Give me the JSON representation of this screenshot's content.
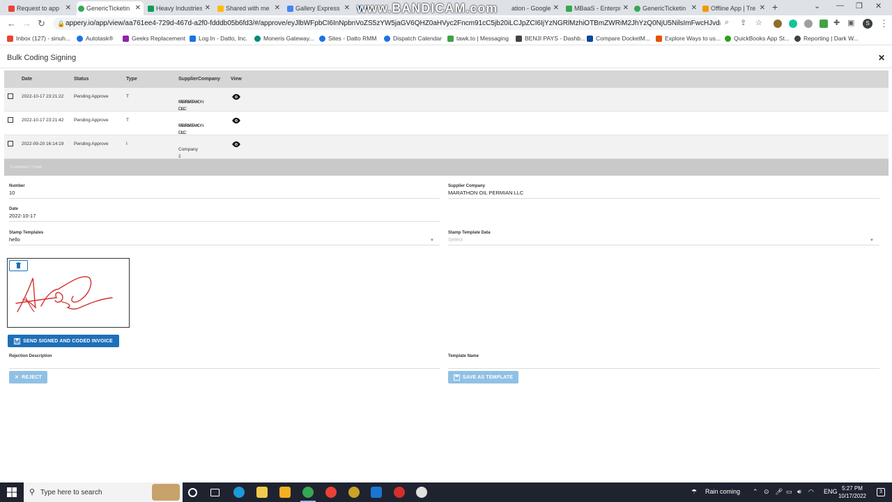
{
  "browser": {
    "tabs": [
      {
        "label": "Request to app",
        "color": "#ea4335"
      },
      {
        "label": "GenericTicketin",
        "color": "#34a853"
      },
      {
        "label": "Heavy Industries",
        "color": "#0f9d58"
      },
      {
        "label": "Shared with me",
        "color": "#fbbc04"
      },
      {
        "label": "Gallery Express",
        "color": "#4285f4"
      },
      {
        "label": "Au",
        "color": "#1a73e8"
      },
      {
        "label": "ation - Google",
        "color": "#4285f4"
      },
      {
        "label": "MBaaS - Enterpr",
        "color": "#34a853"
      },
      {
        "label": "GenericTicketin",
        "color": "#34a853"
      },
      {
        "label": "Offline App | Tre",
        "color": "#f29900"
      }
    ],
    "url": "appery.io/app/view/aa761ee4-729d-467d-a2f0-fdddb05b6fd3/#/approve/eyJlbWFpbCI6InNpbnVoZS5zYW5jaGV6QHZ0aHVyc2Fncm91cC5jb20iLCJpZCI6IjYzNGRlMzhiOTBmZWRiM2JhYzQ0NjU5NilsImFwcHJvdmVySWQiOiI2MzEx...",
    "bandicam": "www.BANDICAM.com",
    "profile_initial": "S",
    "bookmarks": [
      {
        "label": "Inbox (127) - sinuh...",
        "color": "#ea4335"
      },
      {
        "label": "Autotask®",
        "color": "#1a73e8"
      },
      {
        "label": "Geeks Replacement",
        "color": "#8e24aa"
      },
      {
        "label": "Log In - Datto, Inc.",
        "color": "#1a73e8"
      },
      {
        "label": "Moneris Gateway...",
        "color": "#00897b"
      },
      {
        "label": "Sites - Datto RMM",
        "color": "#1a73e8"
      },
      {
        "label": "Dispatch Calendar",
        "color": "#1a73e8"
      },
      {
        "label": "tawk.to | Messaging",
        "color": "#43a047"
      },
      {
        "label": "BENJI PAYS - Dashb...",
        "color": "#424242"
      },
      {
        "label": "Compare DocketM...",
        "color": "#0d47a1"
      },
      {
        "label": "Explore Ways to us...",
        "color": "#e65100"
      },
      {
        "label": "QuickBooks App St...",
        "color": "#2ca01c"
      },
      {
        "label": "Reporting | Dark W...",
        "color": "#424242"
      }
    ]
  },
  "app": {
    "title": "Bulk Coding Signing",
    "table": {
      "columns": [
        "Date",
        "Status",
        "Type",
        "SupplierCompany",
        "View"
      ],
      "rows": [
        {
          "date": "2022-10-17 23:21:22",
          "status": "Pending Approve",
          "type": "T",
          "supplier_line1": "MARATHON OIL",
          "supplier_line2": "PERMIAN LLC"
        },
        {
          "date": "2022-10-17 23:21:42",
          "status": "Pending Approve",
          "type": "T",
          "supplier_line1": "MARATHON OIL",
          "supplier_line2": "PERMIAN LLC"
        },
        {
          "date": "2022-09-20 16:14:19",
          "status": "Pending Approve",
          "type": "I",
          "supplier_line1": "Company 2",
          "supplier_line2": ""
        }
      ],
      "footer": "0 selected / 3 total"
    },
    "form": {
      "number_label": "Number",
      "number_value": "10",
      "supplier_label": "Supplier Company",
      "supplier_value": "MARATHON OIL PERMIAN LLC",
      "date_label": "Date",
      "date_value": "2022-10-17",
      "stamp_templates_label": "Stamp Templates",
      "stamp_templates_value": "hello",
      "stamp_data_label": "Stamp Template Data",
      "stamp_data_placeholder": "Select",
      "rejection_label": "Rejection Description",
      "template_name_label": "Template Name"
    },
    "buttons": {
      "send": "SEND SIGNED AND CODED INVOICE",
      "reject": "REJECT",
      "save_template": "SAVE AS TEMPLATE"
    },
    "colors": {
      "primary": "#1e6fb8",
      "disabled": "#90c1e4",
      "signature": "#d32f2f"
    }
  },
  "taskbar": {
    "search_placeholder": "Type here to search",
    "weather": "Rain coming",
    "language": "ENG",
    "time": "5:27 PM",
    "date": "10/17/2022",
    "notifications": "3"
  }
}
